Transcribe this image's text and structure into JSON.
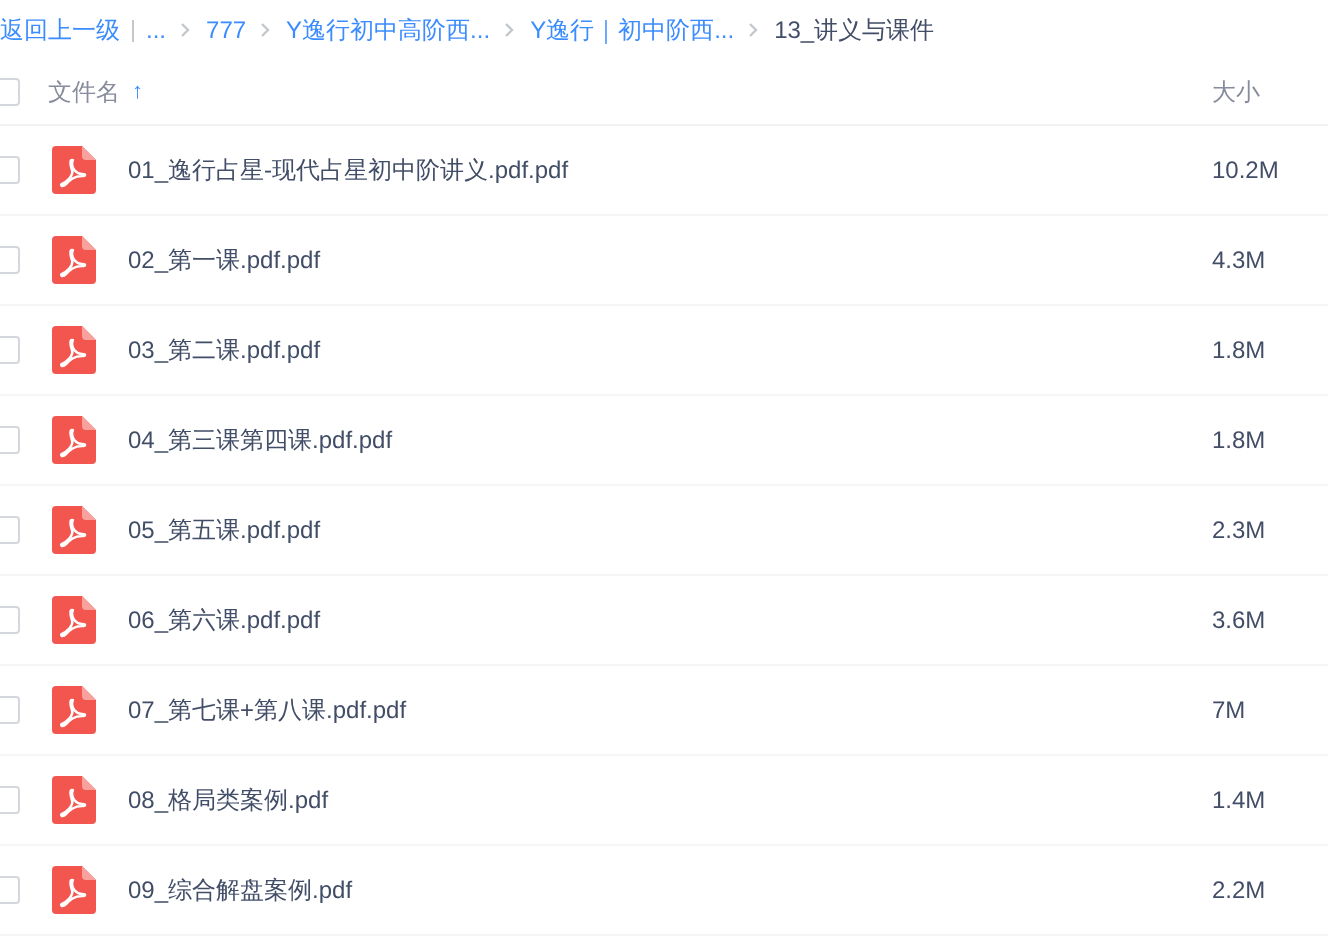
{
  "breadcrumb": {
    "back": "返回上一级",
    "ellipsis": "...",
    "items": [
      {
        "label": "777",
        "current": false
      },
      {
        "label": "Y逸行初中高阶西...",
        "current": false
      },
      {
        "label": "Y逸行｜初中阶西...",
        "current": false
      },
      {
        "label": "13_讲义与课件",
        "current": true
      }
    ]
  },
  "header": {
    "select_all_checked": false,
    "name": "文件名",
    "sort_arrow": "↑",
    "size": "大小"
  },
  "files": [
    {
      "name": "01_逸行占星-现代占星初中阶讲义.pdf.pdf",
      "size": "10.2M",
      "checked": false
    },
    {
      "name": "02_第一课.pdf.pdf",
      "size": "4.3M",
      "checked": false
    },
    {
      "name": "03_第二课.pdf.pdf",
      "size": "1.8M",
      "checked": false
    },
    {
      "name": "04_第三课第四课.pdf.pdf",
      "size": "1.8M",
      "checked": false
    },
    {
      "name": "05_第五课.pdf.pdf",
      "size": "2.3M",
      "checked": false
    },
    {
      "name": "06_第六课.pdf.pdf",
      "size": "3.6M",
      "checked": false
    },
    {
      "name": "07_第七课+第八课.pdf.pdf",
      "size": "7M",
      "checked": false
    },
    {
      "name": "08_格局类案例.pdf",
      "size": "1.4M",
      "checked": false
    },
    {
      "name": "09_综合解盘案例.pdf",
      "size": "2.2M",
      "checked": false
    }
  ]
}
